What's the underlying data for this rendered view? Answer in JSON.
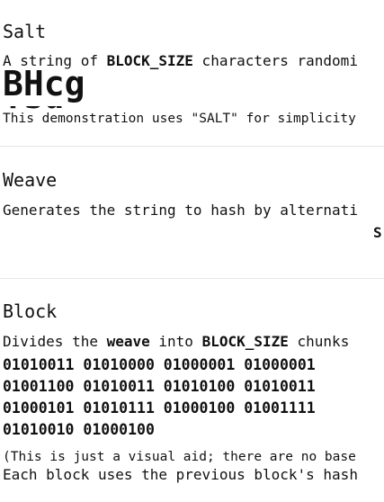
{
  "salt": {
    "heading": "Salt",
    "desc_pre": "A string of ",
    "desc_bold": "BLOCK_SIZE",
    "desc_post": " characters randomi",
    "example": "BHcg",
    "example_overflow": "Tsu",
    "note": "This demonstration uses \"SALT\" for simplicity"
  },
  "weave": {
    "heading": "Weave",
    "desc": "Generates the string to hash by alternati",
    "trailing_char": "S"
  },
  "block": {
    "heading": "Block",
    "desc_pre": "Divides the ",
    "desc_bold1": "weave",
    "desc_mid": " into ",
    "desc_bold2": "BLOCK_SIZE",
    "desc_post": " chunks",
    "binary_rows": [
      "01010011 01010000 01000001 01000001",
      "01001100 01010011 01010100 01010011",
      "01000101 01010111 01000100 01001111",
      "01010010 01000100"
    ],
    "aid_note": "(This is just a visual aid; there are no base",
    "chain_note": "Each block uses the previous block's hash"
  }
}
